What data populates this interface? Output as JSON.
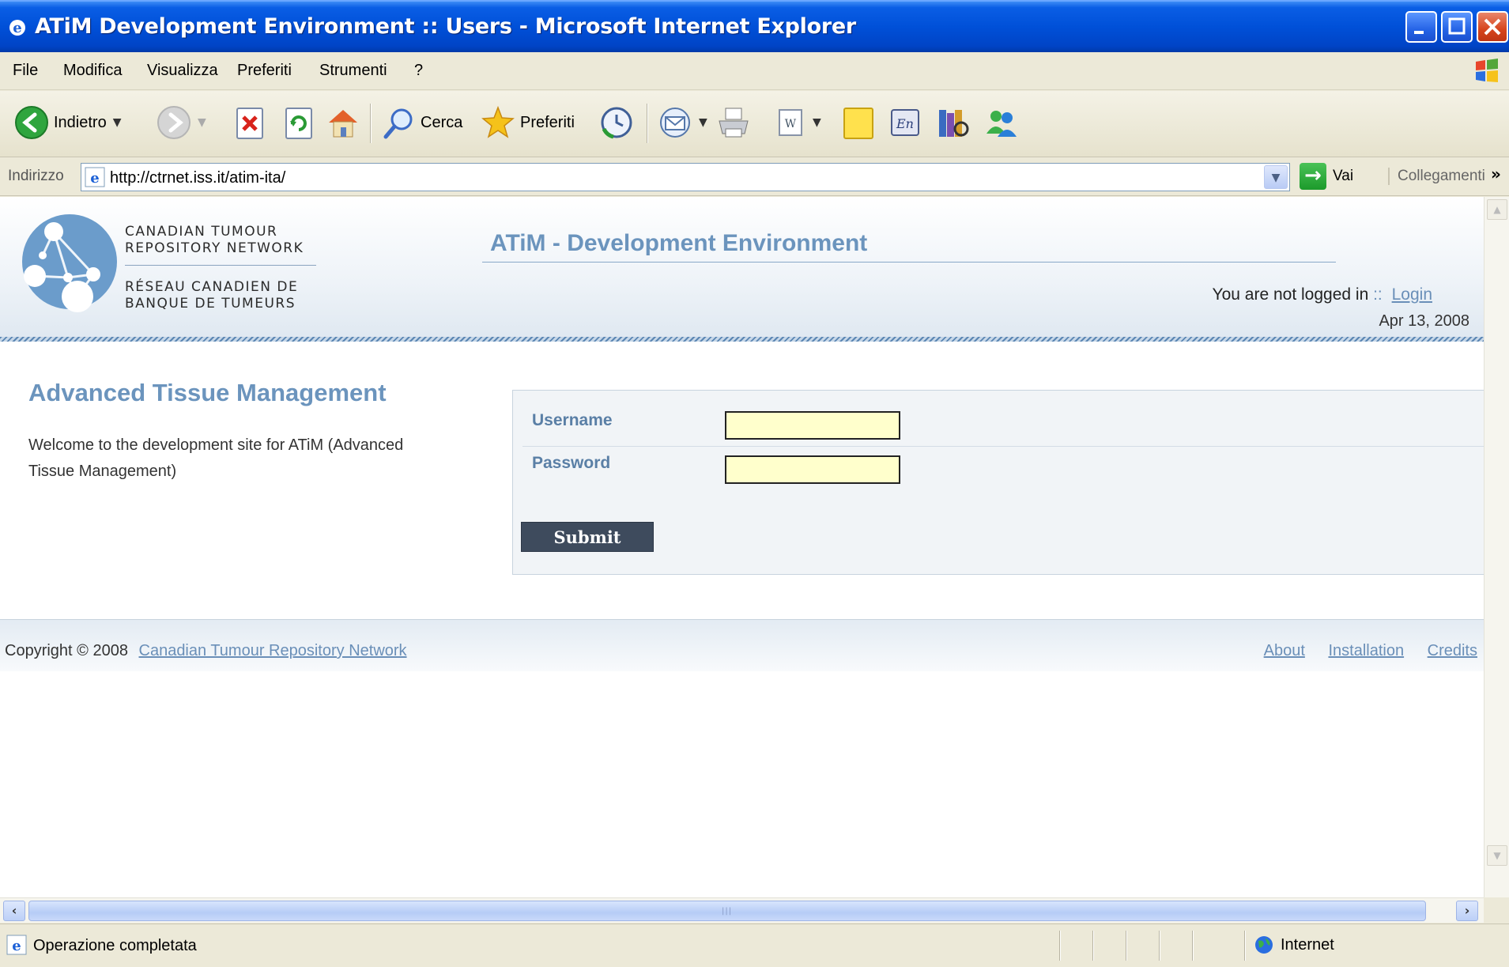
{
  "window": {
    "title": "ATiM Development Environment :: Users - Microsoft Internet Explorer"
  },
  "menu": [
    "File",
    "Modifica",
    "Visualizza",
    "Preferiti",
    "Strumenti",
    "?"
  ],
  "toolbar": {
    "back_label": "Indietro",
    "search_label": "Cerca",
    "favorites_label": "Preferiti"
  },
  "address": {
    "label": "Indirizzo",
    "url": "http://ctrnet.iss.it/atim-ita/",
    "go_label": "Vai",
    "links_label": "Collegamenti",
    "more": "»"
  },
  "header": {
    "org_en_line1": "CANADIAN TUMOUR",
    "org_en_line2": "REPOSITORY NETWORK",
    "org_fr_line1": "RÉSEAU CANADIEN DE",
    "org_fr_line2": "BANQUE DE TUMEURS",
    "site_title": "ATiM - Development Environment",
    "login_status": "You are not logged in",
    "login_sep": "::",
    "login_link": "Login",
    "date": "Apr 13, 2008"
  },
  "main": {
    "title": "Advanced Tissue Management",
    "intro": "Welcome to the development site for ATiM (Advanced Tissue Management)"
  },
  "form": {
    "username_label": "Username",
    "password_label": "Password",
    "username_value": "",
    "password_value": "",
    "submit_label": "Submit"
  },
  "footer": {
    "copyright": "Copyright © 2008",
    "org_link": "Canadian Tumour Repository Network",
    "links": [
      "About",
      "Installation",
      "Credits"
    ]
  },
  "statusbar": {
    "text": "Operazione completata",
    "zone": "Internet"
  },
  "colors": {
    "titlebar": "#0050d8",
    "accent_blue": "#6b94bd",
    "input_bg": "#ffffcc",
    "submit_bg": "#3e4b5d"
  }
}
